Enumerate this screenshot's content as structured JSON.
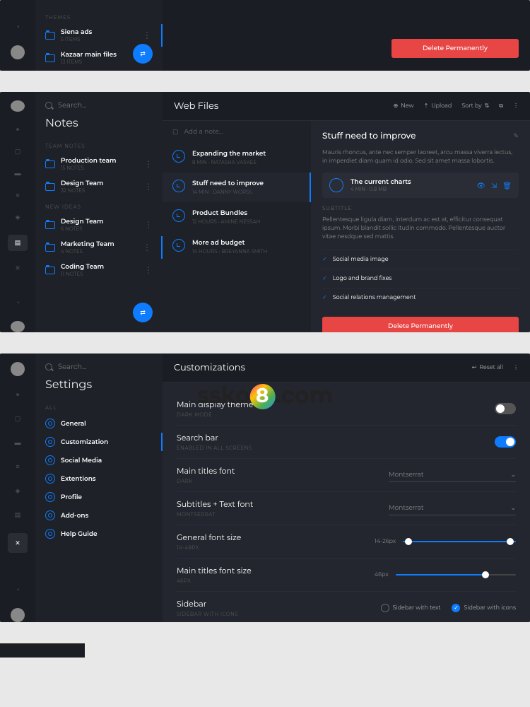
{
  "window1": {
    "section_label": "THEMES",
    "items": [
      {
        "name": "Siena ads",
        "meta": "5 ITEMS"
      },
      {
        "name": "Kazaar main files",
        "meta": "13 ITEMS"
      }
    ],
    "delete": "Delete Permanently"
  },
  "window2": {
    "search_placeholder": "Search...",
    "sidebar_title": "Notes",
    "section1": "TEAM NOTES",
    "section2": "NEW IDEAS",
    "teams1": [
      {
        "name": "Production team",
        "meta": "15 NOTES"
      },
      {
        "name": "Design Team",
        "meta": "32 NOTES"
      }
    ],
    "teams2": [
      {
        "name": "Design Team",
        "meta": "6 NOTES"
      },
      {
        "name": "Marketing Team",
        "meta": "4 NOTES"
      },
      {
        "name": "Coding Team",
        "meta": "11 NOTES"
      }
    ],
    "header_title": "Web Files",
    "new": "New",
    "upload": "Upload",
    "sort": "Sort by",
    "add_note": "Add a note...",
    "notes": [
      {
        "title": "Expanding the market",
        "meta": "8 MIN • NATASHA VASKEE"
      },
      {
        "title": "Stuff need to improve",
        "meta": "14 MIN • DANNY WORSS"
      },
      {
        "title": "Product Bundles",
        "meta": "12 HOURS • AMINE NESSAH"
      },
      {
        "title": "More ad budget",
        "meta": "14 HOURS • BREYANNA SMITH"
      }
    ],
    "detail": {
      "title": "Stuff need to improve",
      "desc": "Mauris rhoncus, ante nec semper laoreet, arcu massa viverra lectus, in imperdiet diam quam id odio. Sed sit amet massa lobortis.",
      "attachment": {
        "name": "The current charts",
        "meta": "4 MIN • 0.8 MB"
      },
      "subtitle_label": "SUBTITLE",
      "subtitle_text": "Pellentesque ligula diam, interdum ac est at, efficitur consequat ipsum. Morbi blandit sollic itudin commodo. Pellentesque auctor vitae nesdque sed mattis.",
      "checks": [
        "Social media image",
        "Logo and brand fixes",
        "Social relations management"
      ],
      "delete": "Delete Permanently"
    }
  },
  "window3": {
    "search_placeholder": "Search...",
    "sidebar_title": "Settings",
    "section": "ALL",
    "items": [
      "General",
      "Customization",
      "Social Media",
      "Extentions",
      "Profile",
      "Add-ons",
      "Help Guide"
    ],
    "header_title": "Customizations",
    "reset": "Reset all",
    "rows": {
      "theme": {
        "lbl": "Main display theme",
        "sub": "DARK MODE"
      },
      "search": {
        "lbl": "Search bar",
        "sub": "ENABLED IN ALL SCREENS"
      },
      "main_font": {
        "lbl": "Main titles font",
        "sub": "DARK",
        "val": "Montserrat"
      },
      "sub_font": {
        "lbl": "Subtitles + Text font",
        "sub": "MONTSERRAT",
        "val": "Montserrat"
      },
      "gen_size": {
        "lbl": "General font size",
        "sub": "14-48PX",
        "val": "14-26px"
      },
      "title_size": {
        "lbl": "Main titles font size",
        "sub": "46PX",
        "val": "46px"
      },
      "sidebar": {
        "lbl": "Sidebar",
        "sub": "SIDEBAR WITH ICONS",
        "opt1": "Sidebar with text",
        "opt2": "Sidebar with icons"
      }
    }
  },
  "watermark": "sskoo.com"
}
